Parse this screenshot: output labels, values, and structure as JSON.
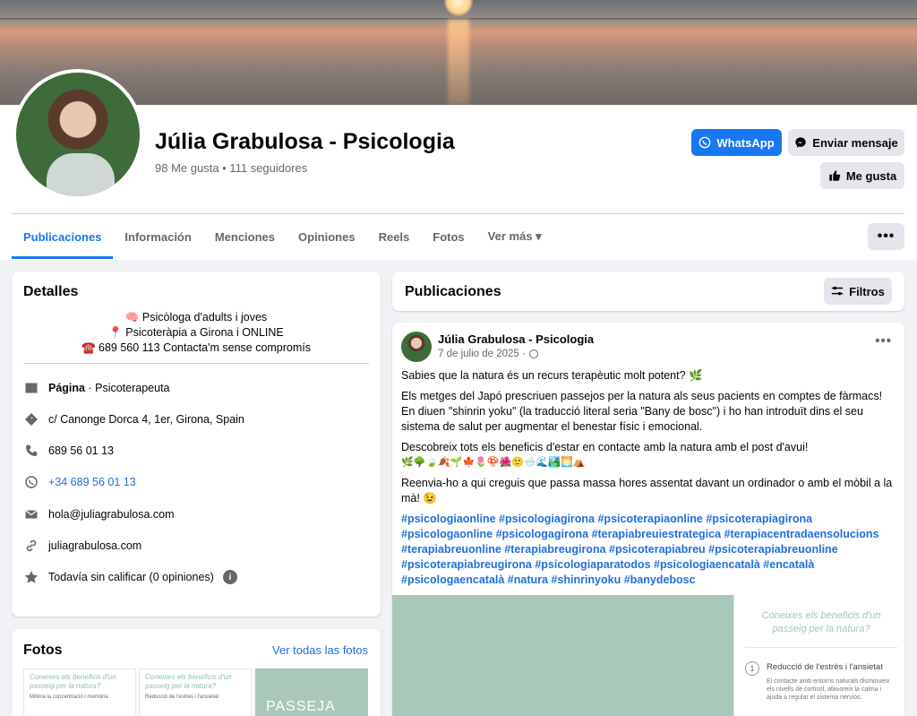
{
  "profile": {
    "name": "Júlia Grabulosa - Psicologia",
    "stats": "98 Me gusta • 111 seguidores"
  },
  "actions": {
    "whatsapp_label": "WhatsApp",
    "message_label": "Enviar mensaje",
    "like_label": "Me gusta",
    "more_label": "•••"
  },
  "tabs": [
    {
      "label": "Publicaciones"
    },
    {
      "label": "Información"
    },
    {
      "label": "Menciones"
    },
    {
      "label": "Opiniones"
    },
    {
      "label": "Reels"
    },
    {
      "label": "Fotos"
    },
    {
      "label": "Ver más ▾"
    }
  ],
  "details": {
    "title": "Detalles",
    "bio_line1": "🧠 Psicòloga d'adults i joves",
    "bio_line2": "📍 Psicoteràpia a Girona i ONLINE",
    "bio_line3": "☎️ 689 560 113 Contacta'm sense compromís",
    "page_type_bold": "Página",
    "page_type_rest": " · Psicoterapeuta",
    "address": "c/ Canonge Dorca 4, 1er, Girona, Spain",
    "phone": "689 56 01 13",
    "whatsapp": "+34 689 56 01 13",
    "email": "hola@juliagrabulosa.com",
    "website": "juliagrabulosa.com",
    "rating": "Todavía sin calificar (0 opiniones)",
    "icons": [
      "page-icon",
      "location-icon",
      "phone-icon",
      "whatsapp-icon",
      "email-icon",
      "link-icon",
      "star-icon",
      "info-icon"
    ]
  },
  "photos": {
    "title": "Fotos",
    "see_all": "Ver todas las fotos",
    "thumb1_title": "Coneixes els beneficis d'un passeig per la natura?",
    "thumb1_text": "Millora la concentració i memòria",
    "thumb2_title": "Coneixes els beneficis d'un passeig per la natura?",
    "thumb2_text": "Reducció de l'estrès i l'ansietat",
    "thumb3_title": "PASSEJA PER"
  },
  "publications": {
    "title": "Publicaciones",
    "filters_label": "Filtros"
  },
  "post": {
    "author": "Júlia Grabulosa - Psicologia",
    "date": "7 de julio de 2025 ·",
    "p1": "Sabies que la natura és un recurs terapèutic molt potent? 🌿",
    "p2": "Els metges del Japó prescriuen passejos per la natura als seus pacients en comptes de fàrmacs! En diuen \"shinrin yoku\" (la traducció literal seria \"Bany de bosc\") i ho han introduït dins el seu sistema de salut per augmentar el benestar físic i emocional.",
    "p3": "Descobreix tots els beneficis d'estar en contacte amb la natura amb el post d'avui!",
    "p3_emoji": "🌿🌳🍃🍂🌱🍁🌷🍄🌺🙂🌧️🌊🏞️🌅⛺",
    "p4": "Reenvia-ho a qui creguis que passa massa hores assentat davant un ordinador o amb el mòbil a la mà! 😉",
    "hashtags": "#psicologiaonline #psicologiagirona #psicoterapiaonline #psicoterapiagirona #psicologaonline #psicologagirona #terapiabreuiestrategica #terapiacentradaensolucions #terapiabreuonline #terapiabreugirona #psicoterapiabreu #psicoterapiabreuonline #psicoterapiabreugirona #psicologiaparatodos #psicologiaencatalà #encatalà #psicologaencatalà #natura #shinrinyoku #banydebosc",
    "image_title": "Coneixes els beneficis d'un passeig per la natura?",
    "image_item_number": "1",
    "image_item_title": "Reducció de l'estrès i l'ansietat",
    "image_item_text": "El contacte amb entorns naturals disminueix els nivells de cortisol, afavoreix la calma i ajuda a regular el sistema nerviós."
  }
}
